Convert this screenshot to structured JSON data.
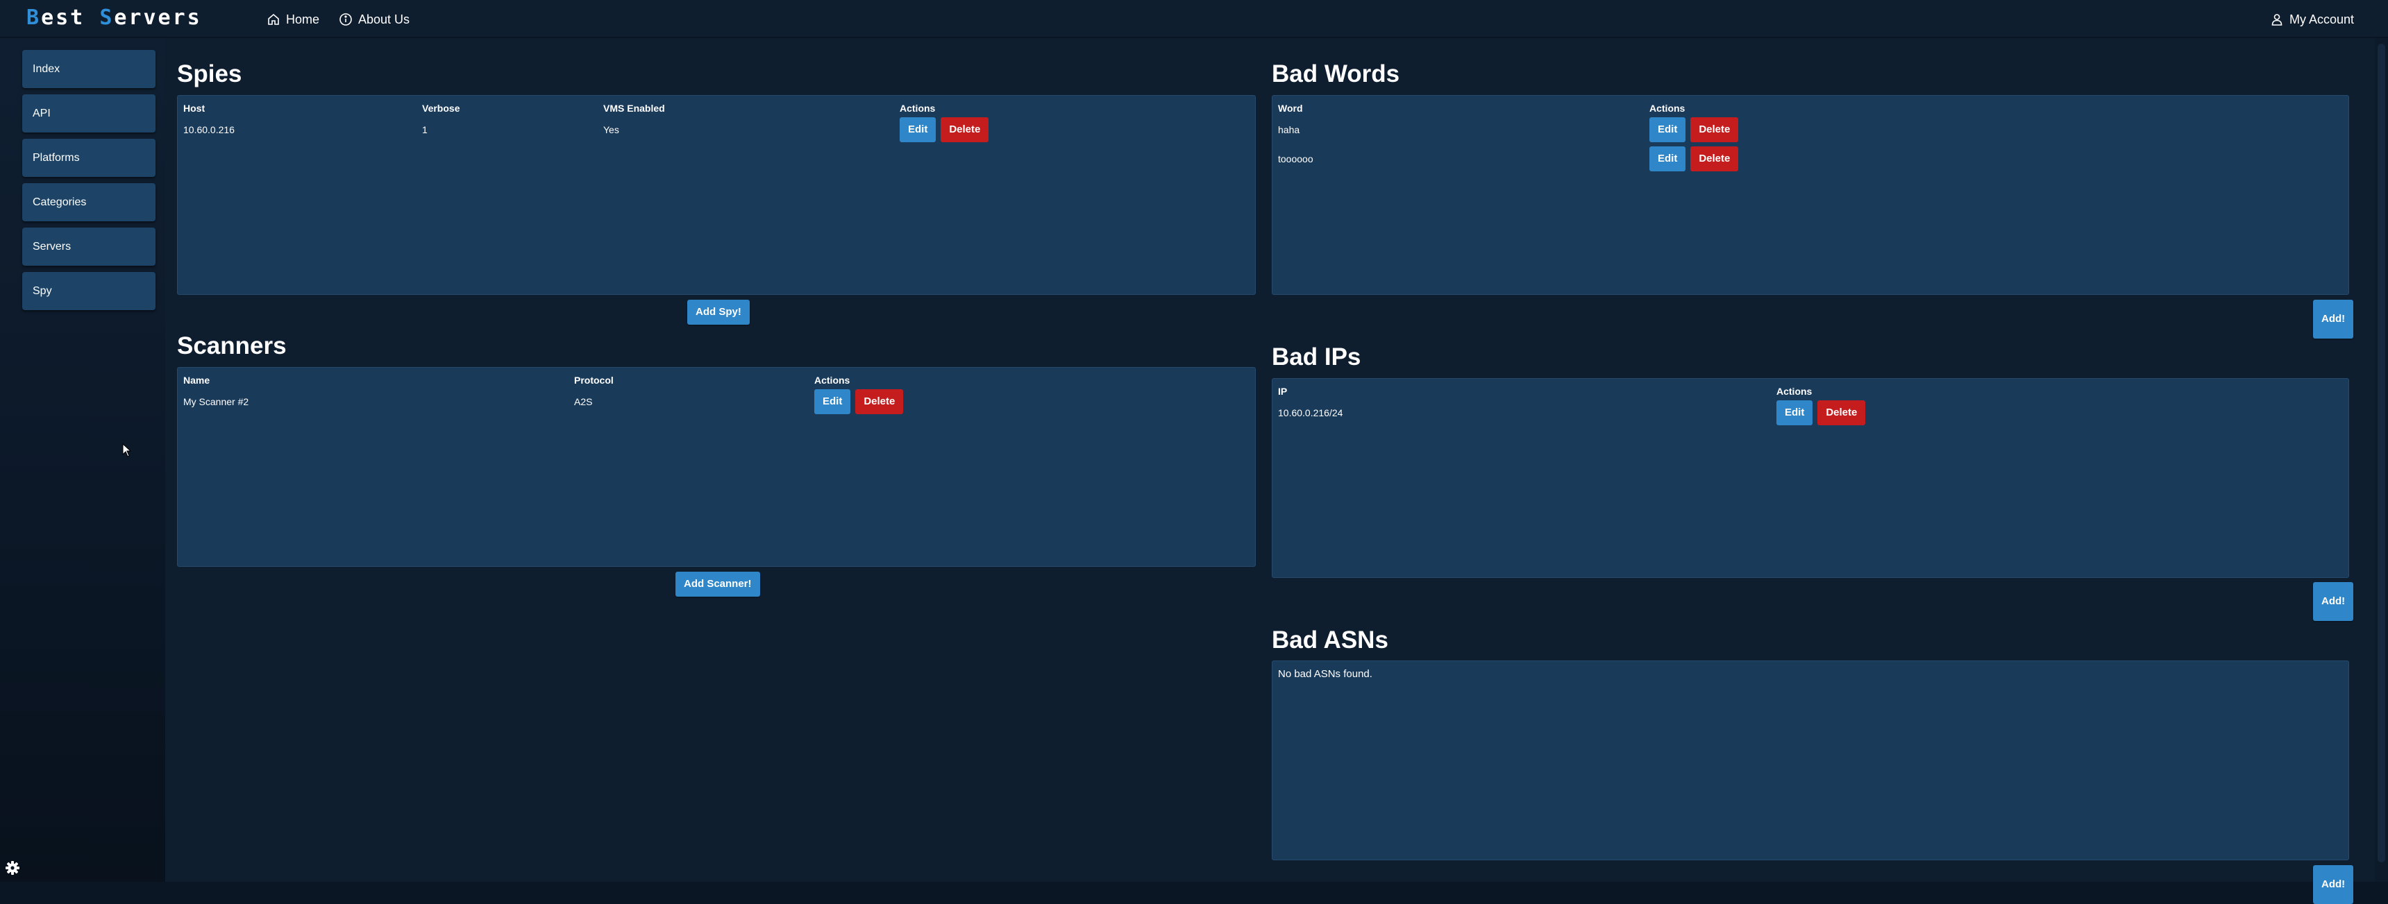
{
  "brand": {
    "first_letter": "B",
    "first_rest": "est",
    "second_letter": "S",
    "second_rest": "ervers",
    "accent_color": "#2f8fd8"
  },
  "nav": {
    "home": "Home",
    "about": "About Us",
    "account": "My Account"
  },
  "sidebar": {
    "items": [
      {
        "label": "Index"
      },
      {
        "label": "API"
      },
      {
        "label": "Platforms"
      },
      {
        "label": "Categories"
      },
      {
        "label": "Servers"
      },
      {
        "label": "Spy"
      }
    ]
  },
  "spies": {
    "title": "Spies",
    "headers": [
      "Host",
      "Verbose",
      "VMS Enabled",
      "Actions"
    ],
    "rows": [
      {
        "host": "10.60.0.216",
        "verbose": "1",
        "vms": "Yes"
      }
    ],
    "add_label": "Add Spy!"
  },
  "scanners": {
    "title": "Scanners",
    "headers": [
      "Name",
      "Protocol",
      "Actions"
    ],
    "rows": [
      {
        "name": "My Scanner #2",
        "protocol": "A2S"
      }
    ],
    "add_label": "Add Scanner!"
  },
  "bad_words": {
    "title": "Bad Words",
    "headers": [
      "Word",
      "Actions"
    ],
    "rows": [
      {
        "word": "haha"
      },
      {
        "word": "toooooo"
      }
    ],
    "add_label": "Add!"
  },
  "bad_ips": {
    "title": "Bad IPs",
    "headers": [
      "IP",
      "Actions"
    ],
    "rows": [
      {
        "ip": "10.60.0.216/24"
      }
    ],
    "add_label": "Add!"
  },
  "bad_asns": {
    "title": "Bad ASNs",
    "empty": "No bad ASNs found.",
    "add_label": "Add!"
  },
  "actions": {
    "edit": "Edit",
    "delete": "Delete"
  },
  "colors": {
    "edit": "#2f86c8",
    "delete": "#c51d1d",
    "panel": "#1a3a5a",
    "sidebar_item": "#1d4466"
  }
}
